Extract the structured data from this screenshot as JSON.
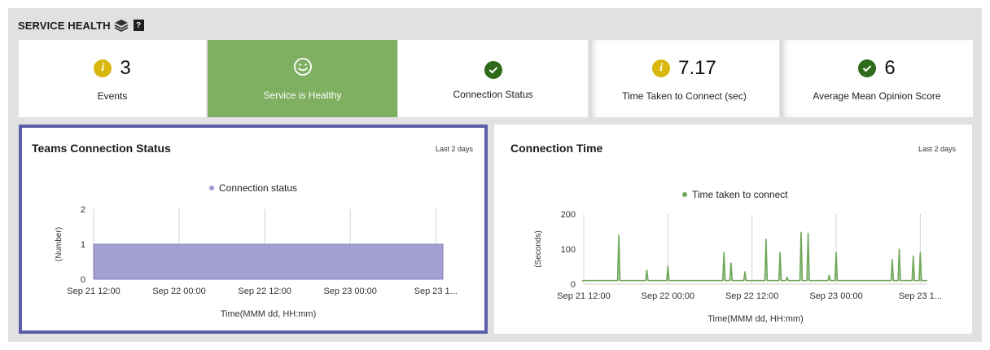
{
  "header": {
    "title": "SERVICE HEALTH",
    "layers_icon": "layers-icon",
    "help_label": "?"
  },
  "tiles": [
    {
      "icon": "info-icon",
      "value": "3",
      "label": "Events"
    },
    {
      "icon": "smiley-icon",
      "label": "Service is Healthy",
      "color": "#7fb061"
    },
    {
      "icon": "check-icon",
      "label": "Connection Status"
    },
    {
      "icon": "info-icon",
      "value": "7.17",
      "label": "Time Taken to Connect (sec)"
    },
    {
      "icon": "check-icon",
      "value": "6",
      "label": "Average Mean Opinion Score"
    }
  ],
  "panels": [
    {
      "title": "Teams Connection Status",
      "range": "Last 2 days"
    },
    {
      "title": "Connection Time",
      "range": "Last 2 days"
    }
  ],
  "chart_data": [
    {
      "type": "area",
      "legend": [
        "Connection status"
      ],
      "series": [
        {
          "name": "Connection status",
          "color": "#9e9bcf",
          "x": [
            "Sep 21 12:00",
            "Sep 23 13:00"
          ],
          "values": [
            1,
            1
          ]
        }
      ],
      "ylabel": "(Number)",
      "xlabel": "Time(MMM dd, HH:mm)",
      "yticks": [
        "0",
        "1",
        "2"
      ],
      "ylim": [
        0,
        2
      ],
      "xticks": [
        "Sep 21 12:00",
        "Sep 22 00:00",
        "Sep 22 12:00",
        "Sep 23 00:00",
        "Sep 23 1..."
      ],
      "grid": "vertical"
    },
    {
      "type": "line",
      "legend": [
        "Time taken to connect"
      ],
      "series": [
        {
          "name": "Time taken to connect",
          "color": "#6fa85a",
          "x": [
            "Sep 21 12:00",
            "Sep 21 17:00",
            "Sep 21 21:00",
            "Sep 22 00:00",
            "Sep 22 08:00",
            "Sep 22 09:00",
            "Sep 22 11:00",
            "Sep 22 14:00",
            "Sep 22 16:00",
            "Sep 22 17:00",
            "Sep 22 19:00",
            "Sep 22 20:00",
            "Sep 22 23:00",
            "Sep 23 00:00",
            "Sep 23 08:00",
            "Sep 23 09:00",
            "Sep 23 11:00",
            "Sep 23 12:00"
          ],
          "values": [
            10,
            140,
            40,
            50,
            90,
            60,
            35,
            128,
            90,
            20,
            148,
            145,
            25,
            90,
            70,
            100,
            80,
            90
          ]
        }
      ],
      "ylabel": "(Seconds)",
      "xlabel": "Time(MMM dd, HH:mm)",
      "yticks": [
        "0",
        "100",
        "200"
      ],
      "ylim": [
        0,
        200
      ],
      "xticks": [
        "Sep 21 12:00",
        "Sep 22 00:00",
        "Sep 22 12:00",
        "Sep 23 00:00",
        "Sep 23 1..."
      ],
      "grid": "vertical",
      "baseline": 10
    }
  ]
}
